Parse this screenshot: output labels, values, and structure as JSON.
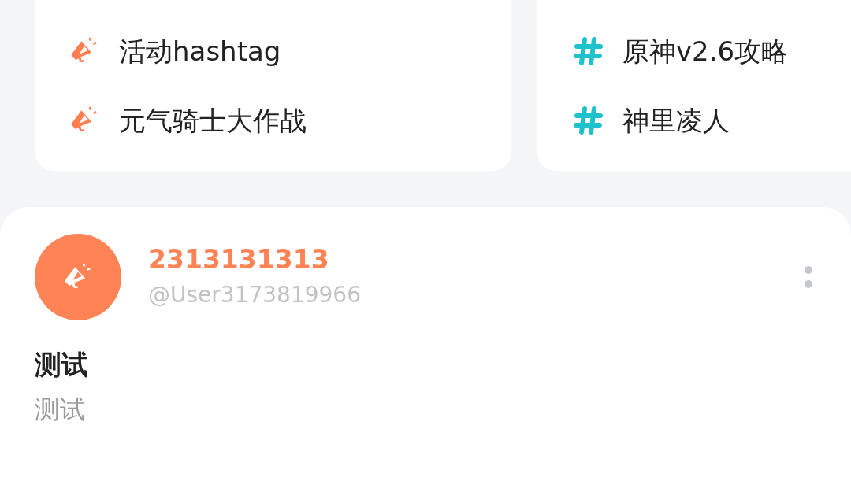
{
  "topic_cards": [
    {
      "tags": [
        {
          "kind": "event",
          "label": "活动hashtag"
        },
        {
          "kind": "event",
          "label": "元气骑士大作战"
        }
      ]
    },
    {
      "tags": [
        {
          "kind": "topic",
          "label": "原神v2.6攻略"
        },
        {
          "kind": "topic",
          "label": "神里凌人"
        }
      ]
    }
  ],
  "post": {
    "author": {
      "name": "2313131313",
      "handle": "@User3173819966"
    },
    "title": "测试",
    "body": "测试"
  }
}
